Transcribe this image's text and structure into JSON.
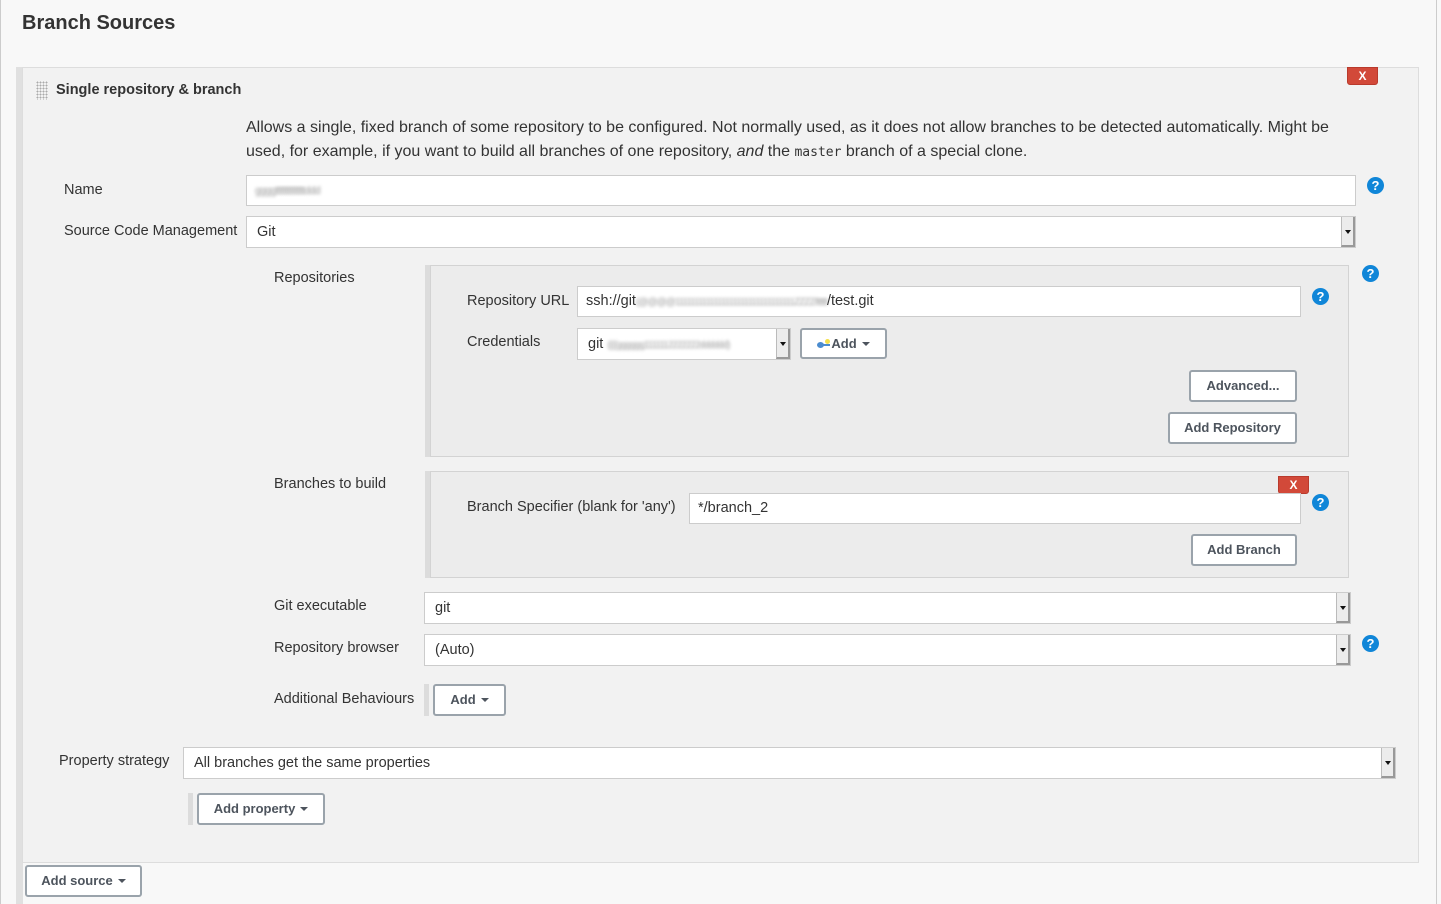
{
  "section": {
    "title": "Branch Sources"
  },
  "source": {
    "title": "Single repository & branch",
    "delete_label": "X",
    "description": {
      "part1": "Allows a single, fixed branch of some repository to be configured. Not normally used, as it does not allow branches to be detected automatically. Might be used, for example, if you want to build all branches of one repository, ",
      "emphasis": "and",
      "part2": " the ",
      "code": "master",
      "part3": " branch of a special clone."
    },
    "name": {
      "label": "Name",
      "value": "ggggttttttttttttttddd"
    },
    "scm": {
      "label": "Source Code Management",
      "value": "Git"
    },
    "repositories": {
      "label": "Repositories",
      "url_label": "Repository URL",
      "url_prefix": "ssh://git",
      "url_redacted": "(@@@@1111111111111111111111111111111ZZZZ/tttttt",
      "url_suffix": "/test.git",
      "credentials_label": "Credentials",
      "credentials_prefix": "git",
      "credentials_redacted": "((((gggggg1111112222222dddddd)",
      "add_credentials_label": "Add",
      "advanced_label": "Advanced...",
      "add_repository_label": "Add Repository"
    },
    "branches": {
      "label": "Branches to build",
      "delete_label": "X",
      "specifier_label": "Branch Specifier (blank for 'any')",
      "specifier_value": "*/branch_2",
      "add_branch_label": "Add Branch"
    },
    "git_executable": {
      "label": "Git executable",
      "value": "git"
    },
    "repository_browser": {
      "label": "Repository browser",
      "value": "(Auto)"
    },
    "additional_behaviours": {
      "label": "Additional Behaviours",
      "add_label": "Add"
    },
    "property_strategy": {
      "label": "Property strategy",
      "value": "All branches get the same properties"
    },
    "add_property_label": "Add property"
  },
  "add_source_label": "Add source",
  "help_glyph": "?",
  "colors": {
    "delete": "#d24939",
    "help": "#1086d8",
    "button_border": "#9aa3ab"
  }
}
